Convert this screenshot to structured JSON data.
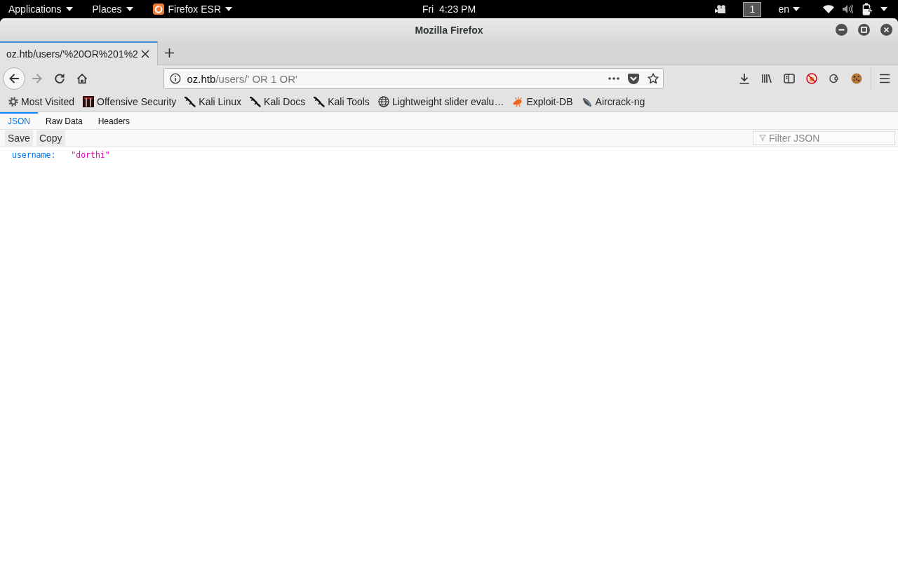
{
  "top_panel": {
    "menus": [
      {
        "label": "Applications"
      },
      {
        "label": "Places"
      }
    ],
    "app_menu": {
      "label": "Firefox ESR"
    },
    "clock": "Fri  4:23 PM",
    "workspace": "1",
    "keyboard_layout": "en"
  },
  "window": {
    "title": "Mozilla Firefox"
  },
  "tabs": [
    {
      "title": "oz.htb/users/'%20OR%201%2",
      "selected": true
    }
  ],
  "navigation": {
    "back": {
      "disabled": false
    },
    "forward": {
      "disabled": true
    }
  },
  "address_bar": {
    "host": "oz.htb",
    "path": "/users/' OR 1 OR'"
  },
  "bookmarks": [
    {
      "label": "Most Visited",
      "kind": "folder"
    },
    {
      "label": "Offensive Security",
      "kind": "tile"
    },
    {
      "label": "Kali Linux",
      "kind": "squiggle"
    },
    {
      "label": "Kali Docs",
      "kind": "squiggle"
    },
    {
      "label": "Kali Tools",
      "kind": "squiggle"
    },
    {
      "label": "Lightweight slider evalu…",
      "kind": "globe"
    },
    {
      "label": "Exploit-DB",
      "kind": "bug"
    },
    {
      "label": "Aircrack-ng",
      "kind": "dish"
    }
  ],
  "viewer": {
    "tabs": [
      {
        "label": "JSON",
        "selected": true
      },
      {
        "label": "Raw Data",
        "selected": false
      },
      {
        "label": "Headers",
        "selected": false
      }
    ],
    "buttons": [
      "Save",
      "Copy"
    ],
    "filter": {
      "placeholder": "Filter JSON"
    },
    "rows": [
      {
        "key": "username:",
        "value": "\"dorthi\""
      }
    ]
  }
}
